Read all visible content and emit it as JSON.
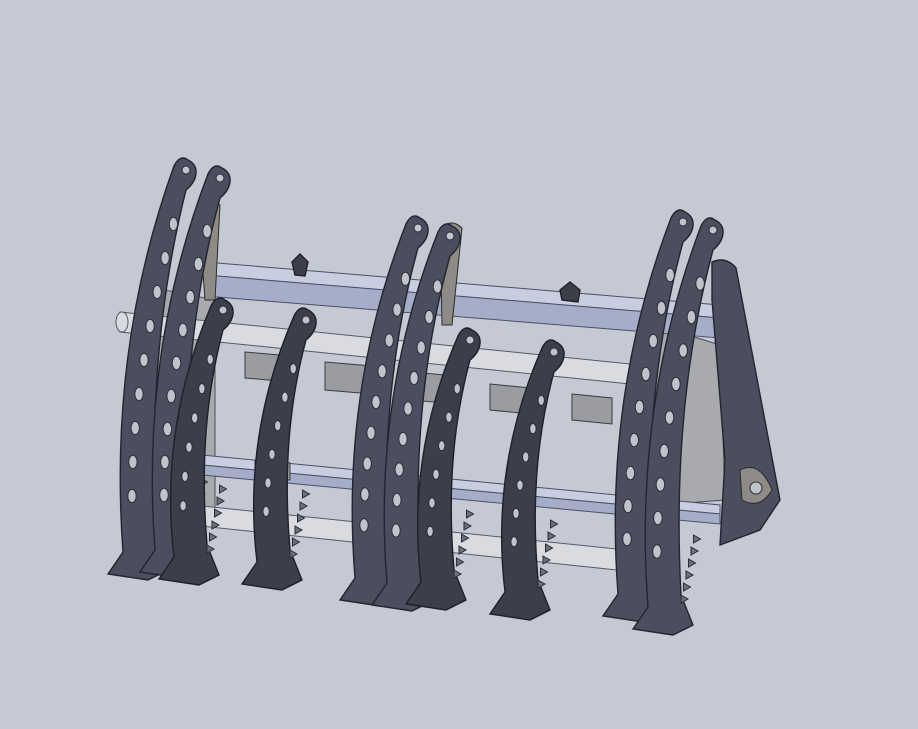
{
  "scene": {
    "colors": {
      "background": "#c4c9d4",
      "steel": "#4a4e5e",
      "tube": "#d9dbe0",
      "rail": "#a6adc8"
    }
  }
}
